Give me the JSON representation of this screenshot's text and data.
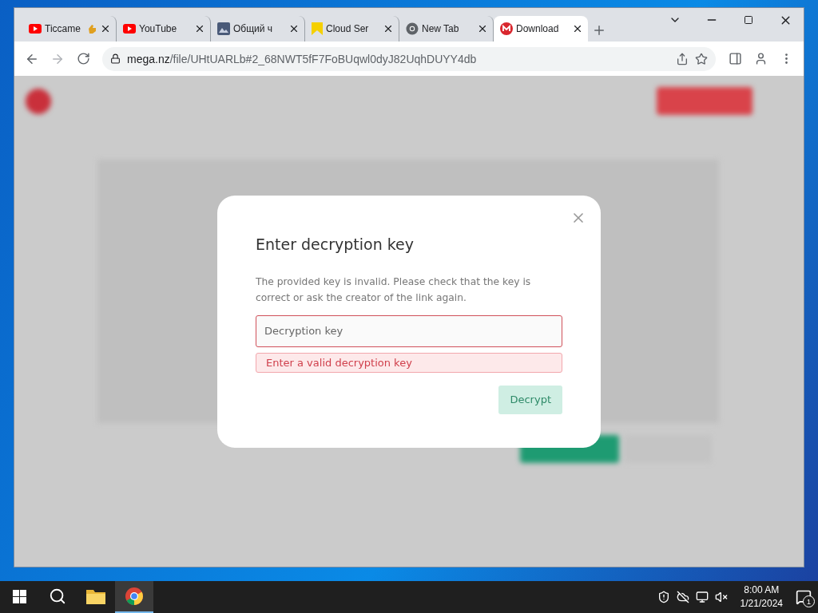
{
  "browser": {
    "tabs": [
      {
        "title": "Ticcame",
        "kind": "youtube",
        "extra_icon": true,
        "selected": false
      },
      {
        "title": "YouTube",
        "kind": "youtube",
        "extra_icon": false,
        "selected": false
      },
      {
        "title": "Общий ч",
        "kind": "image",
        "extra_icon": false,
        "selected": false
      },
      {
        "title": "Cloud Ser",
        "kind": "yellow",
        "extra_icon": false,
        "selected": false
      },
      {
        "title": "New Tab",
        "kind": "chrome",
        "extra_icon": false,
        "selected": false
      },
      {
        "title": "Download",
        "kind": "mega",
        "extra_icon": false,
        "selected": true
      }
    ],
    "url_host": "mega.nz",
    "url_path": "/file/UHtUARLb#2_68NWT5fF7FoBUqwl0dyJ82UqhDUYY4db"
  },
  "modal": {
    "title": "Enter decryption key",
    "message": "The provided key is invalid. Please check that the key is correct or ask the creator of the link again.",
    "field": {
      "placeholder": "Decryption key",
      "invalid": true
    },
    "error": "Enter a valid decryption key",
    "button": {
      "label": "Decrypt",
      "disabled": true
    }
  },
  "taskbar": {
    "apps": [
      {
        "kind": "folder",
        "active": false
      },
      {
        "kind": "chrome",
        "active": true
      }
    ],
    "time": "8:00 AM",
    "date": "1/21/2024",
    "notifications": "1"
  }
}
